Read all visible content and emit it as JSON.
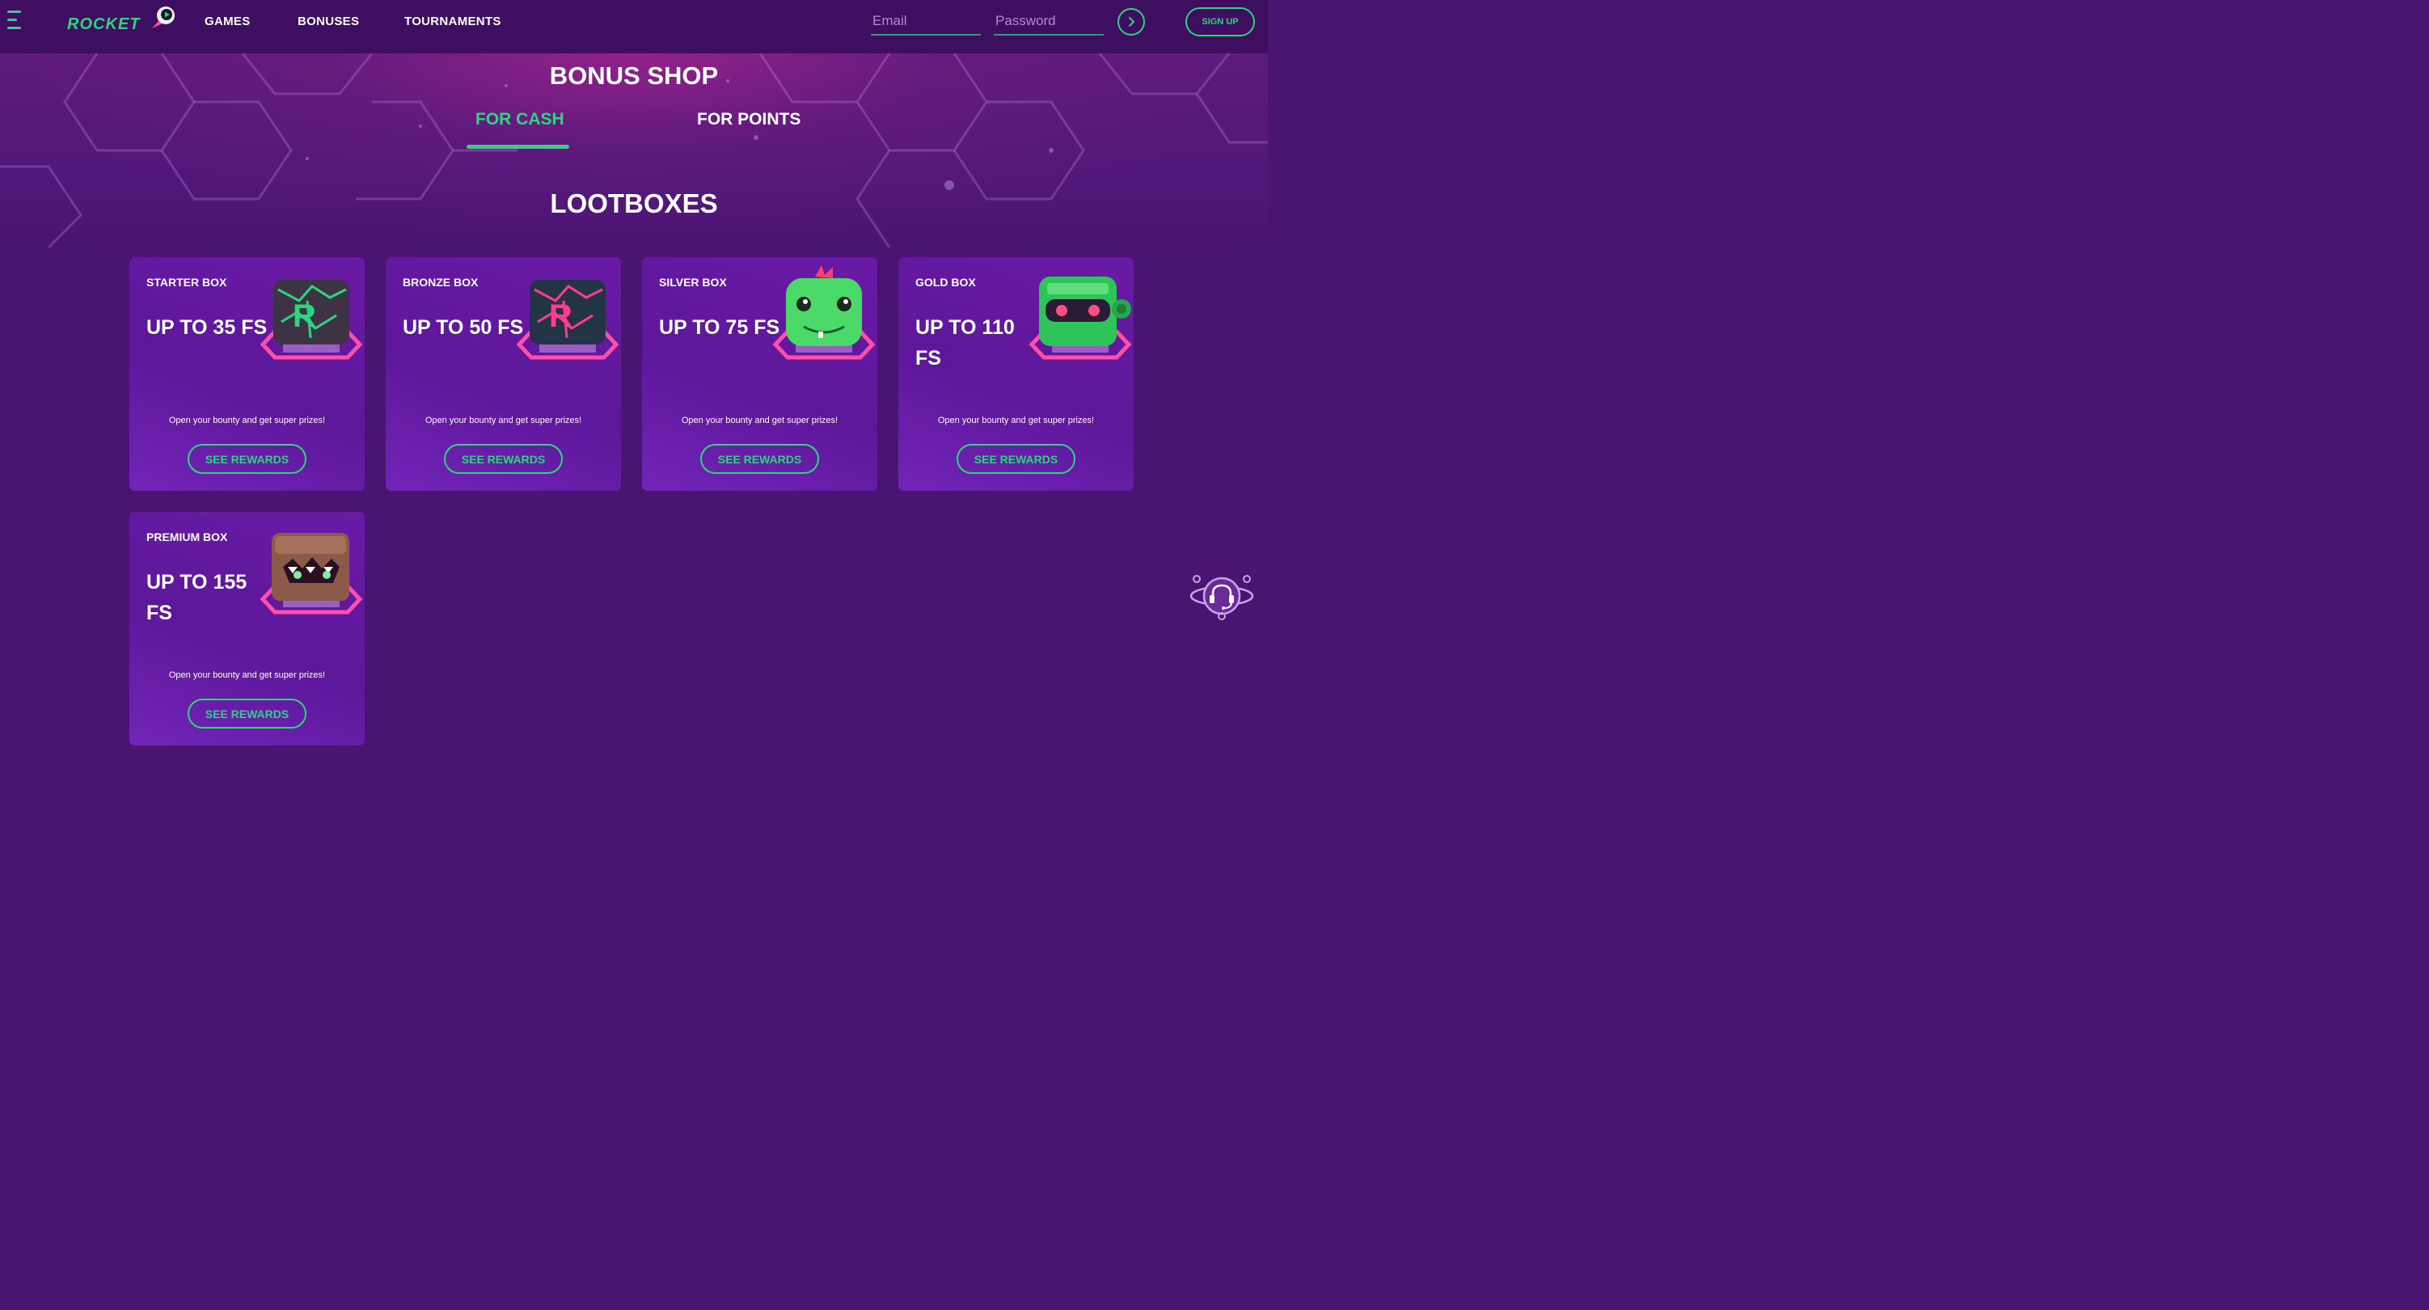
{
  "header": {
    "logo_text": "ROCKET",
    "nav": [
      "GAMES",
      "BONUSES",
      "TOURNAMENTS"
    ],
    "email_placeholder": "Email",
    "password_placeholder": "Password",
    "signup_label": "SIGN UP"
  },
  "page": {
    "title": "BONUS SHOP",
    "tabs": [
      {
        "label": "FOR CASH",
        "active": true
      },
      {
        "label": "FOR POINTS",
        "active": false
      }
    ],
    "section_title": "LOOTBOXES"
  },
  "cards": [
    {
      "name": "STARTER BOX",
      "value": "UP TO 35 FS",
      "description": "Open your bounty and get super prizes!",
      "button": "SEE REWARDS",
      "icon": "starter-box-icon"
    },
    {
      "name": "BRONZE BOX",
      "value": "UP TO 50 FS",
      "description": "Open your bounty and get super prizes!",
      "button": "SEE REWARDS",
      "icon": "bronze-box-icon"
    },
    {
      "name": "SILVER BOX",
      "value": "UP TO 75 FS",
      "description": "Open your bounty and get super prizes!",
      "button": "SEE REWARDS",
      "icon": "silver-box-icon"
    },
    {
      "name": "GOLD BOX",
      "value": "UP TO 110 FS",
      "description": "Open your bounty and get super prizes!",
      "button": "SEE REWARDS",
      "icon": "gold-box-icon"
    },
    {
      "name": "PREMIUM BOX",
      "value": "UP TO 155 FS",
      "description": "Open your bounty and get super prizes!",
      "button": "SEE REWARDS",
      "icon": "premium-box-icon"
    }
  ],
  "colors": {
    "accent": "#2ad77c",
    "background": "#4a1473",
    "header": "#3e0f60",
    "card": "#5d179a",
    "pedestal": "#ff4fa8"
  }
}
